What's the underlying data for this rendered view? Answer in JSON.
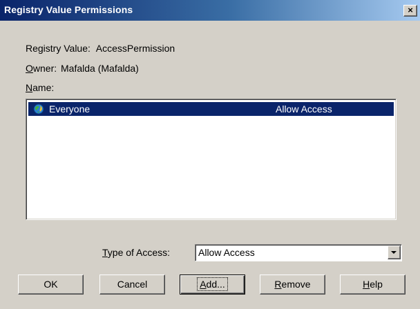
{
  "window": {
    "title": "Registry Value Permissions",
    "close_glyph": "×"
  },
  "info": {
    "registry_value_label": "Registry Value:",
    "registry_value": "AccessPermission",
    "owner_label_mnemonic": "O",
    "owner_label_rest": "wner:",
    "owner_value": "Mafalda (Mafalda)",
    "name_label_mnemonic": "N",
    "name_label_rest": "ame:"
  },
  "list": {
    "rows": [
      {
        "name": "Everyone",
        "access": "Allow Access",
        "icon": "globe-icon",
        "selected": true
      }
    ]
  },
  "type_of_access": {
    "label_mnemonic": "T",
    "label_rest": "ype of Access:",
    "value": "Allow Access"
  },
  "buttons": {
    "ok": "OK",
    "cancel": "Cancel",
    "add_mnemonic": "A",
    "add_rest": "dd...",
    "remove_mnemonic": "R",
    "remove_rest": "emove",
    "help_mnemonic": "H",
    "help_rest": "elp"
  },
  "colors": {
    "dialog_bg": "#d4d0c8",
    "titlebar_start": "#0a246a",
    "titlebar_end": "#a6caf0",
    "selection": "#0a246a"
  }
}
